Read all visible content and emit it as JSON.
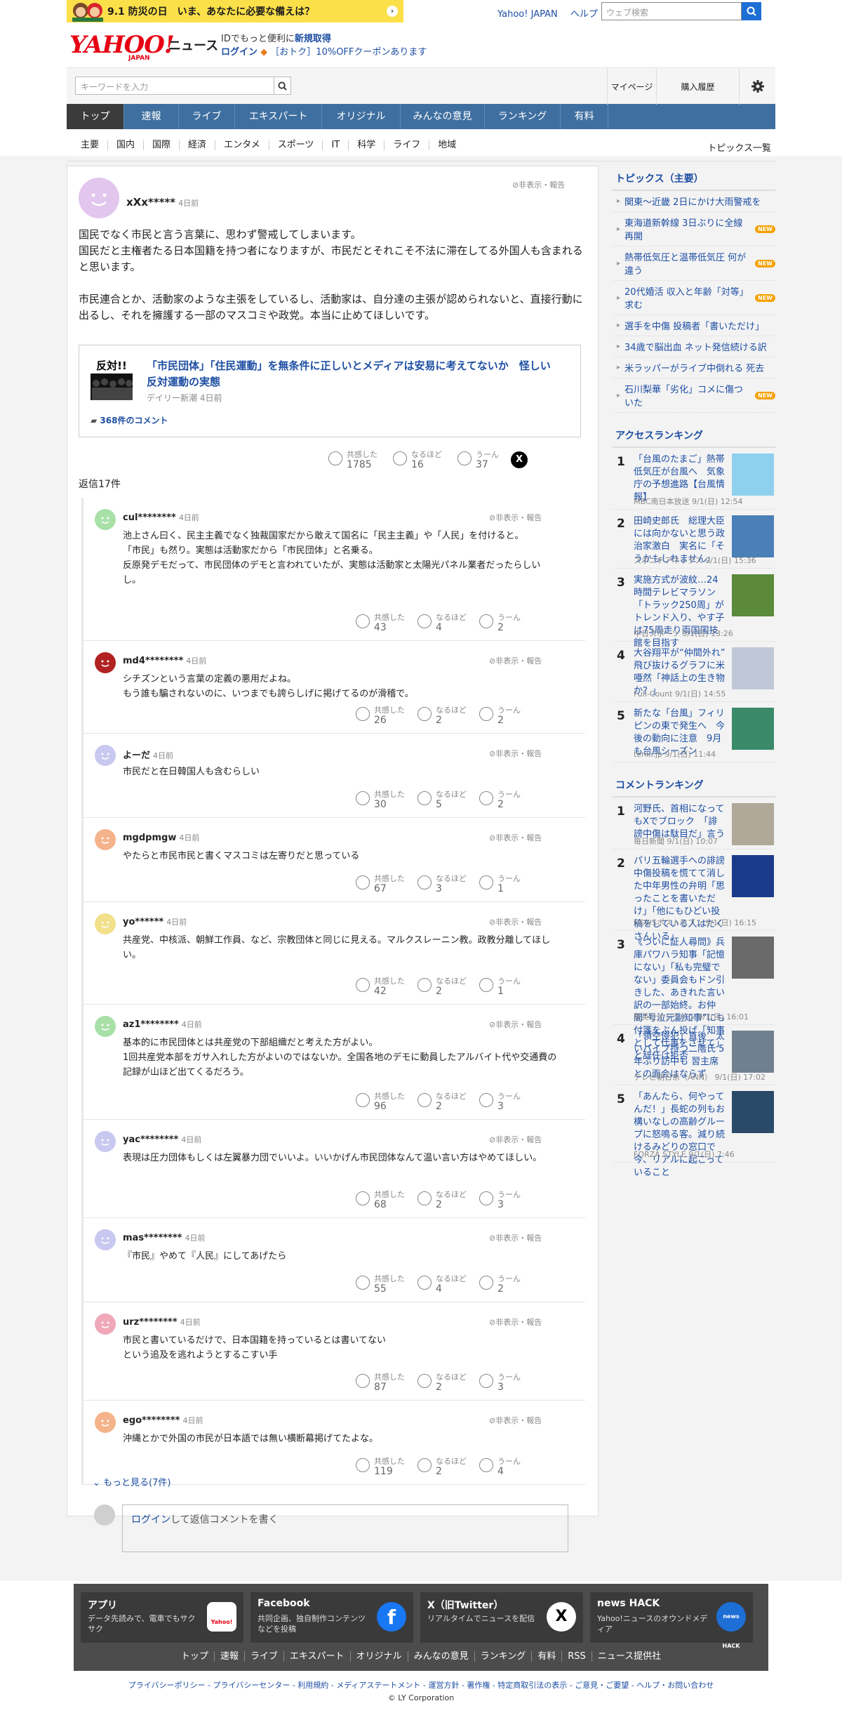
{
  "banner": {
    "text": "9.1 防災の日　いま、あなたに必要な備えは？"
  },
  "toplinks": [
    "Yahoo! JAPAN",
    "ヘルプ"
  ],
  "top_search": {
    "placeholder": "ウェブ検索"
  },
  "logo": {
    "brand": "YAHOO!",
    "sub": "JAPAN",
    "section": "ニュース"
  },
  "login": {
    "line1_prefix": "IDでもっと便利に",
    "line1_link": "新規取得",
    "line2_link": "ログイン",
    "line2_text": "［おトク］10%OFFクーポンあります"
  },
  "search": {
    "placeholder": "キーワードを入力"
  },
  "utils": [
    "マイページ",
    "購入履歴"
  ],
  "nav": [
    "トップ",
    "速報",
    "ライブ",
    "エキスパート",
    "オリジナル",
    "みんなの意見",
    "ランキング",
    "有料"
  ],
  "subnav": [
    "主要",
    "国内",
    "国際",
    "経済",
    "エンタメ",
    "スポーツ",
    "IT",
    "科学",
    "ライフ",
    "地域"
  ],
  "subnav_right": "トピックス一覧",
  "hide_report": "非表示・報告",
  "parent": {
    "user": "xXx*****",
    "time": "4日前",
    "text": "国民でなく市民と言う言葉に、思わず警戒してしまいます。\n国民だと主権者たる日本国籍を持つ者になりますが、市民だとそれこそ不法に滞在してる外国人も含まれると思います。\n\n市民連合とか、活動家のような主張をしているし、活動家は、自分達の主張が認められないと、直接行動に出るし、それを擁護する一部のマスコミや政党。本当に止めてほしいです。",
    "article": {
      "thumb_text": "反対!!",
      "title": "「市民団体」「住民運動」を無条件に正しいとメディアは安易に考えてないか　怪しい反対運動の実態",
      "source": "デイリー新潮 4日前",
      "comments": "368件のコメント"
    },
    "reactions": [
      {
        "label": "共感した",
        "count": "1785"
      },
      {
        "label": "なるほど",
        "count": "16"
      },
      {
        "label": "うーん",
        "count": "37"
      }
    ],
    "x_label": "X",
    "replies_label": "返信17件"
  },
  "replies": [
    {
      "user": "cul********",
      "time": "4日前",
      "color": "#a8e0a8",
      "text": "池上さん曰く、民主主義でなく独裁国家だから敢えて国名に「民主主義」や「人民」を付けると。\n「市民」も然り。実態は活動家だから「市民団体」と名乗る。\n反原発デモだって、市民団体のデモと言われていたが、実態は活動家と太陽光パネル業者だったらしいし。",
      "r": [
        "43",
        "4",
        "2"
      ]
    },
    {
      "user": "md4********",
      "time": "4日前",
      "color": "#b22222",
      "text": "シチズンという言葉の定義の悪用だよね。\nもう誰も騙されないのに、いつまでも誇らしげに掲げてるのが滑稽で。",
      "r": [
        "26",
        "2",
        "2"
      ]
    },
    {
      "user": "よーだ",
      "time": "4日前",
      "color": "#c8c8f0",
      "text": "市民だと在日韓国人も含むらしい",
      "r": [
        "30",
        "5",
        "2"
      ]
    },
    {
      "user": "mgdpmgw",
      "time": "4日前",
      "color": "#f4b38a",
      "text": "やたらと市民市民と書くマスコミは左寄りだと思っている",
      "r": [
        "67",
        "3",
        "1"
      ]
    },
    {
      "user": "yo******",
      "time": "4日前",
      "color": "#f2e08a",
      "text": "共産党、中核派、朝鮮工作員、など、宗教団体と同じに見える。マルクスレーニン教。政教分離してほしい。",
      "r": [
        "42",
        "2",
        "1"
      ]
    },
    {
      "user": "az1********",
      "time": "4日前",
      "color": "#a8e0a8",
      "text": "基本的に市民団体とは共産党の下部組織だと考えた方がよい。\n1回共産党本部をガサ入れした方がよいのではないか。全国各地のデモに動員したアルバイト代や交通費の記録が山ほど出てくるだろう。",
      "r": [
        "96",
        "2",
        "3"
      ]
    },
    {
      "user": "yac********",
      "time": "4日前",
      "color": "#c8c8f0",
      "text": "表現は圧力団体もしくは左翼暴力団でいいよ。いいかげん市民団体なんて温い言い方はやめてほしい。",
      "r": [
        "68",
        "2",
        "3"
      ]
    },
    {
      "user": "mas********",
      "time": "4日前",
      "color": "#c8c8f0",
      "text": "『市民』やめて『人民』にしてあげたら",
      "r": [
        "55",
        "4",
        "2"
      ]
    },
    {
      "user": "urz********",
      "time": "4日前",
      "color": "#f0a8b8",
      "text": "市民と書いているだけで、日本国籍を持っているとは書いてない\nという追及を逃れようとするこすい手",
      "r": [
        "87",
        "2",
        "3"
      ]
    },
    {
      "user": "ego********",
      "time": "4日前",
      "color": "#f4b38a",
      "text": "沖縄とかで外国の市民が日本語では無い横断幕掲げてたよな。",
      "r": [
        "119",
        "2",
        "4"
      ]
    }
  ],
  "reaction_labels": [
    "共感した",
    "なるほど",
    "うーん"
  ],
  "more": "もっと見る(7件)",
  "reply_box": {
    "login": "ログイン",
    "text": "して返信コメントを書く"
  },
  "side": {
    "topics_title": "トピックス（主要）",
    "topics": [
      {
        "t": "関東～近畿 2日にかけ大雨警戒を",
        "new": false
      },
      {
        "t": "東海道新幹線 3日ぶりに全線再開",
        "new": true
      },
      {
        "t": "熱帯低気圧と温帯低気圧 何が違う",
        "new": true
      },
      {
        "t": "20代婚活 収入と年齢「対等」求む",
        "new": true
      },
      {
        "t": "選手を中傷 投稿者「書いただけ」",
        "new": false
      },
      {
        "t": "34歳で脳出血 ネット発信続ける訳",
        "new": false
      },
      {
        "t": "米ラッパーがライブ中倒れる 死去",
        "new": false
      },
      {
        "t": "石川梨華「劣化」コメに傷ついた",
        "new": true
      }
    ],
    "new_label": "NEW",
    "access_title": "アクセスランキング",
    "access": [
      {
        "n": "1",
        "t": "「台風のたまご」熱帯低気圧が台風へ　気象庁の予想進路【台風情報】",
        "m": "MBC南日本放送 9/1(日) 12:54",
        "c": "#8fd0ee"
      },
      {
        "n": "2",
        "t": "田崎史郎氏　総理大臣には向かないと思う政治家激白　実名に「そうかもしれません」",
        "m": "スポニチアネックス 9/1(日) 15:36",
        "c": "#4a7fb8"
      },
      {
        "n": "3",
        "t": "実施方式が波紋…24時間テレビマラソン「トラック250周」がトレンド入り、やす子は75周走り両国国技館を目指す",
        "m": "中日スポーツ 9/1(日) 13:26",
        "c": "#5a8a3a"
      },
      {
        "n": "4",
        "t": "大谷翔平が“仲間外れ” 飛び抜けるグラフに米唖然「神話上の生き物か？」",
        "m": "Full-Count 9/1(日) 14:55",
        "c": "#c0c8d8"
      },
      {
        "n": "5",
        "t": "新たな「台風」フィリピンの東で発生へ　今後の動向に注意　9月も台風シーズン",
        "m": "tenki.jp 9/1(日) 11:44",
        "c": "#3a8a6a"
      }
    ],
    "comment_title": "コメントランキング",
    "comment": [
      {
        "n": "1",
        "t": "河野氏、首相になってもXでブロック　「誹謗中傷は駄目だ」言う",
        "m": "毎日新聞 9/1(日) 10:07",
        "c": "#b0a898"
      },
      {
        "n": "2",
        "t": "パリ五輪選手への誹謗中傷投稿を慌てて消した中年男性の弁明「思ったことを書いただけ」「他にもひどい投稿をしている人はたくさんいる」",
        "m": "NEWSポストセブン 9/1(日) 16:15",
        "c": "#1a3a8a"
      },
      {
        "n": "3",
        "t": "《ついに証人尋問》兵庫パワハラ知事「記憶にない」「私も完璧でない」委員会もドン引きした、あきれた言い訳の一部始終。お仲間“号泣元副知事”にも付箋をぶん投げ「知事として仕事をさせて」と辞任は拒否",
        "m": "集英社オンライン 9/1(日) 16:01",
        "c": "#6a6a6a"
      },
      {
        "n": "4",
        "t": "「領空侵犯」直後　太いパイプ持つ二階氏 5年ぶり訪中も 習主席との面会はならず",
        "m": "テレビ朝日系（ANN） 9/1(日) 17:02",
        "c": "#708090"
      },
      {
        "n": "5",
        "t": "「あんたら、何やってんだ！」長蛇の列もお構いなしの高齢グループに怒鳴る客。減り続けるみどりの窓口で今、リアルに起こっていること",
        "m": "FORZA STYLE 9/1(日) 7:46",
        "c": "#2a4a6a"
      }
    ]
  },
  "footer": {
    "cards": [
      {
        "h": "アプリ",
        "d": "データ先読みで、電車でもサクサク"
      },
      {
        "h": "Facebook",
        "d": "共同企画、独自制作コンテンツなどを投稿"
      },
      {
        "h": "X（旧Twitter）",
        "d": "リアルタイムでニュースを配信"
      },
      {
        "h": "news HACK",
        "d": "Yahoo!ニュースのオウンドメディア"
      }
    ],
    "icons": [
      "app-icon",
      "facebook-icon",
      "x-icon",
      "newshack-icon"
    ],
    "icon_text": {
      "app": "Yahoo!",
      "x": "X",
      "newshack": "news HACK"
    },
    "links": [
      "トップ",
      "速報",
      "ライブ",
      "エキスパート",
      "オリジナル",
      "みんなの意見",
      "ランキング",
      "有料",
      "RSS",
      "ニュース提供社"
    ],
    "legal": "プライバシーポリシー - プライバシーセンター - 利用規約 - メディアステートメント - 運営方針 - 著作権 - 特定商取引法の表示 - ご意見・ご要望 - ヘルプ・お問い合わせ",
    "copyright": "© LY Corporation"
  }
}
